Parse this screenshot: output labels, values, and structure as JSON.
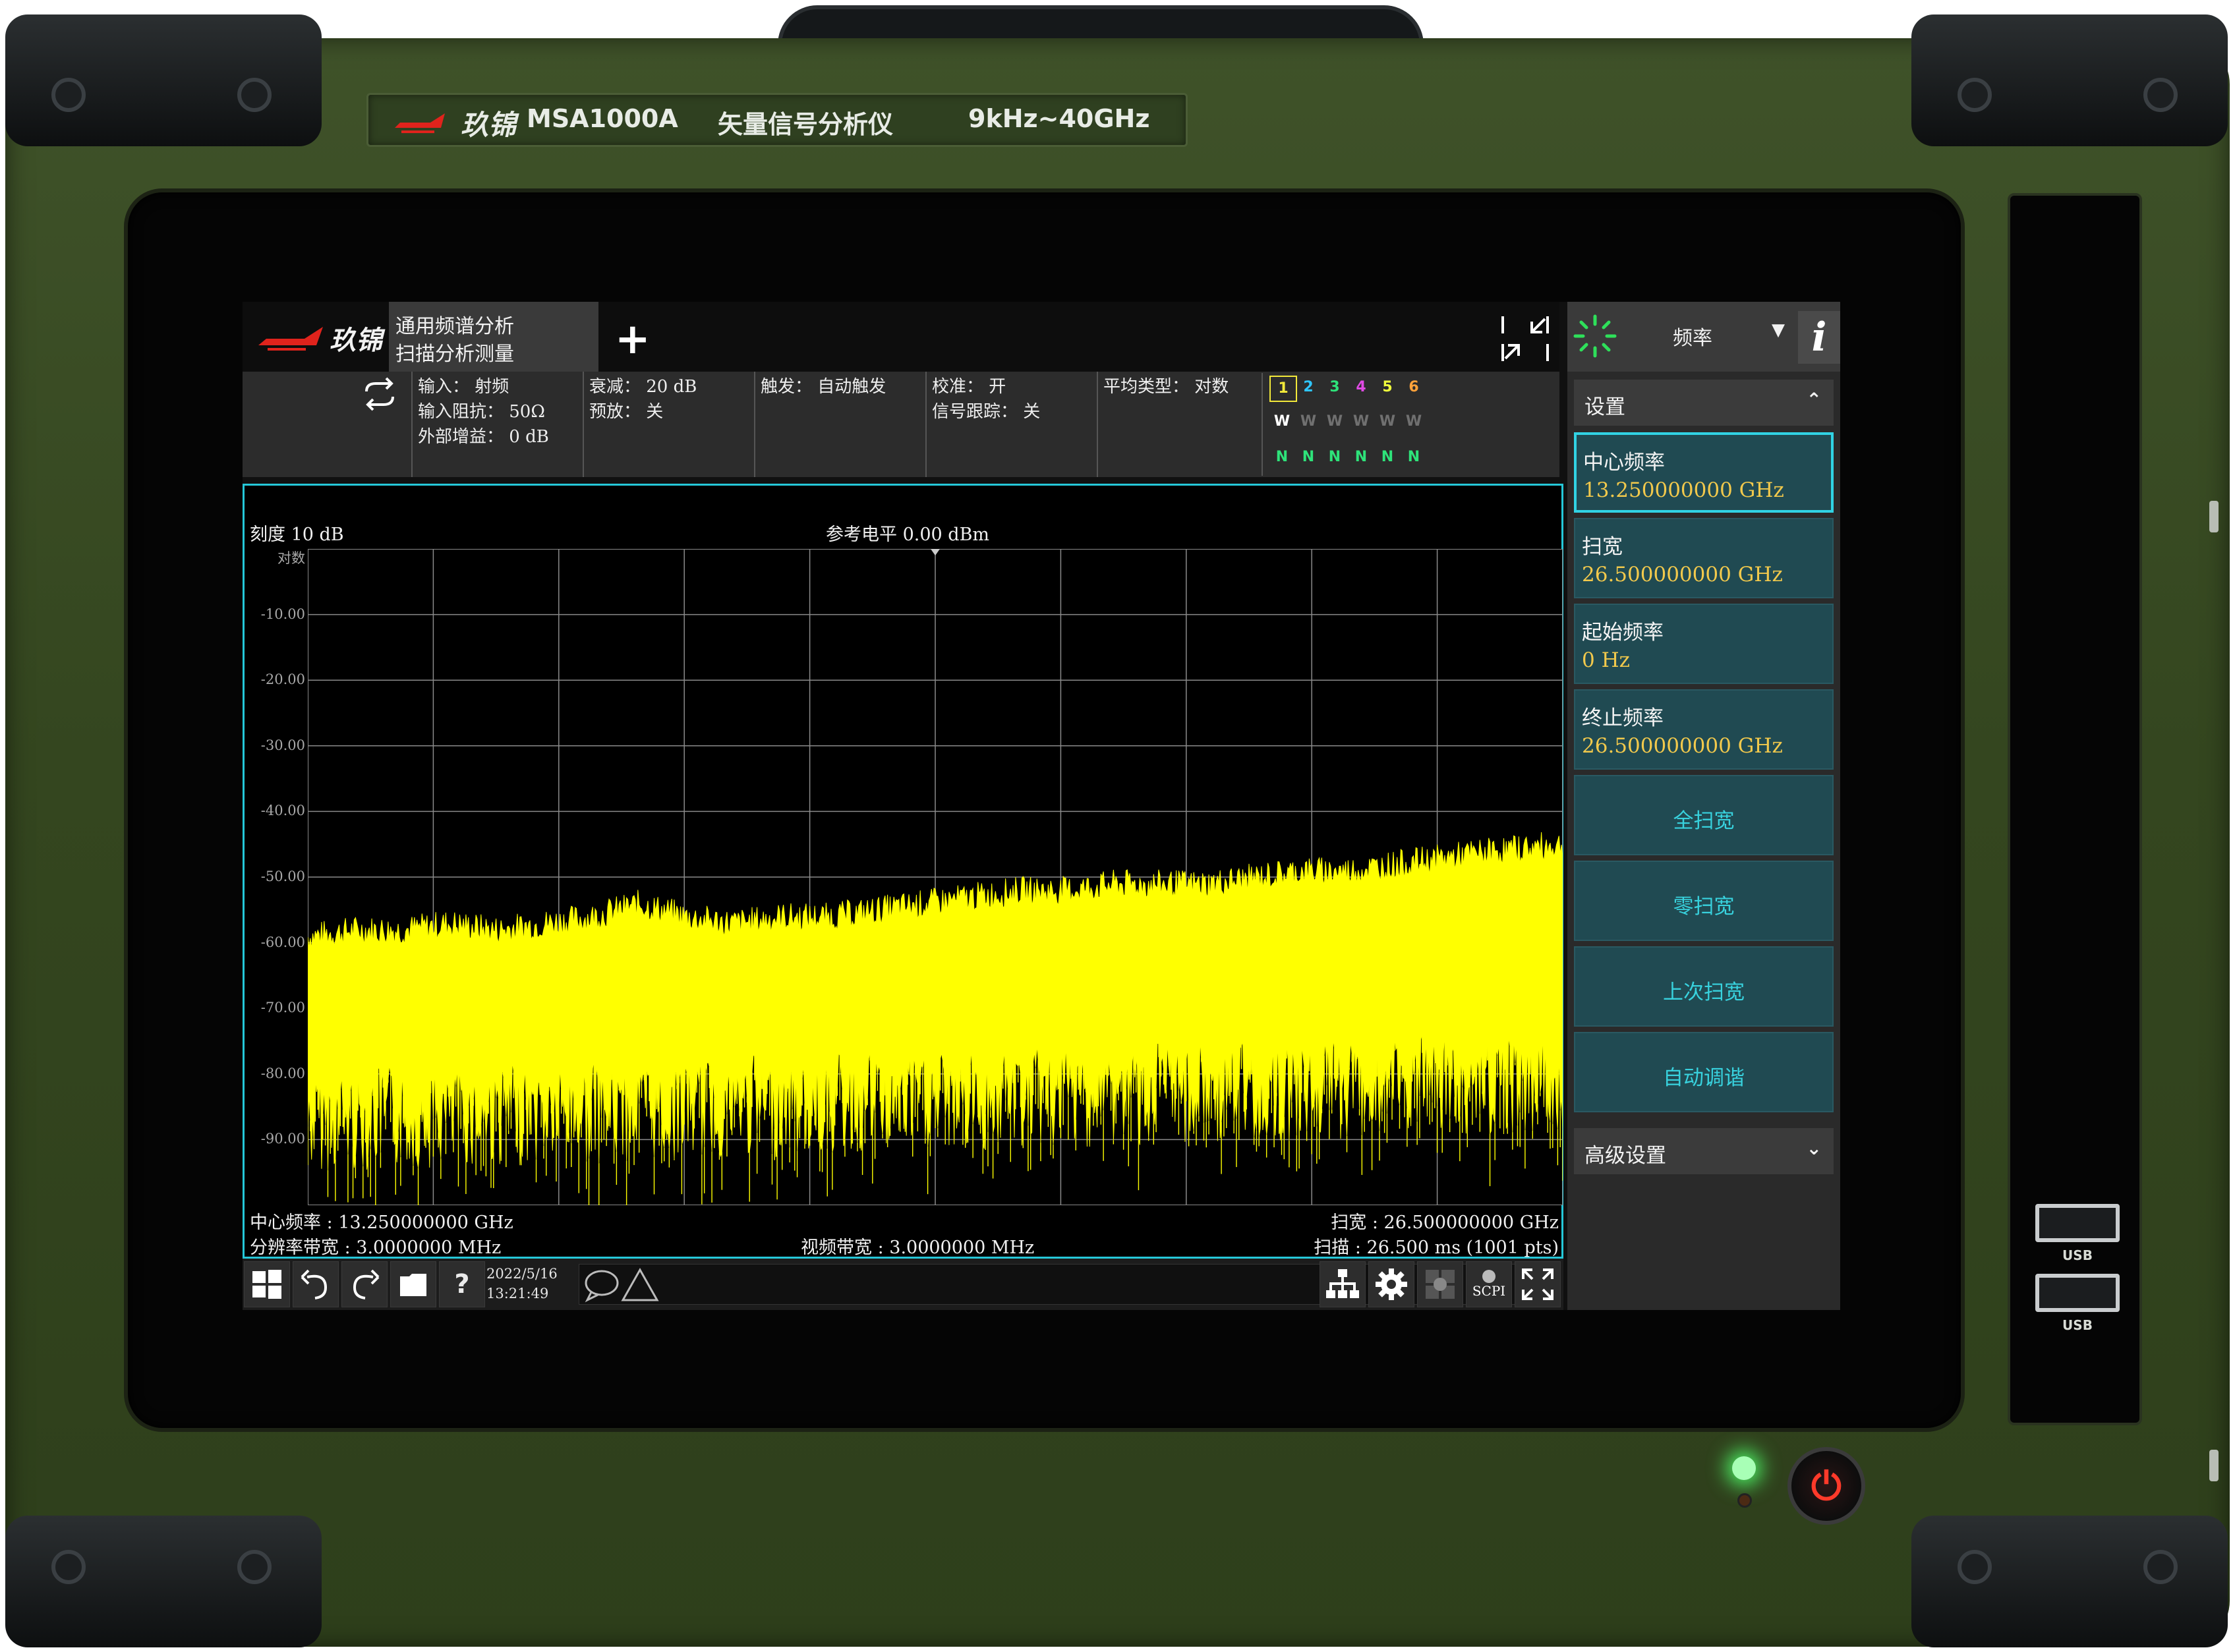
{
  "device": {
    "brand": "玖锦",
    "model": "MSA1000A",
    "description": "矢量信号分析仪",
    "range": "9kHz~40GHz",
    "usb_label": "USB",
    "chassis_color": "#34461f",
    "led_color": "#4fff6a",
    "power_icon": "power-icon"
  },
  "header": {
    "brand": "玖锦",
    "measurement_line1": "通用频谱分析",
    "measurement_line2": "扫描分析测量",
    "add_label": "+",
    "restore_icon": "restore-icon"
  },
  "status": {
    "col1": [
      "输入： 射频",
      "输入阻抗： 50Ω",
      "外部增益： 0 dB"
    ],
    "col2": [
      "衰减： 20 dB",
      "预放： 关"
    ],
    "col3": [
      "触发： 自动触发"
    ],
    "col4": [
      "校准： 开",
      "信号跟踪： 关"
    ],
    "col5": [
      "平均类型： 对数"
    ],
    "traces": {
      "numbers": [
        "1",
        "2",
        "3",
        "4",
        "5",
        "6"
      ],
      "number_colors": [
        "#f2e93a",
        "#2fc6ff",
        "#2ee37a",
        "#e04ae4",
        "#f0ff3c",
        "#ffa23a"
      ],
      "modes": [
        "W",
        "W",
        "W",
        "W",
        "W",
        "W"
      ],
      "detectors": [
        "N",
        "N",
        "N",
        "N",
        "N",
        "N"
      ]
    }
  },
  "graph": {
    "scale": "刻度 10 dB",
    "ref_level": "参考电平 0.00 dBm",
    "log_label": "对数",
    "y_ticks": [
      "-10.00",
      "-20.00",
      "-30.00",
      "-40.00",
      "-50.00",
      "-60.00",
      "-70.00",
      "-80.00",
      "-90.00"
    ],
    "center_freq": "中心频率 : 13.250000000 GHz",
    "rbw": "分辨率带宽 : 3.0000000 MHz",
    "vbw": "视频带宽 : 3.0000000 MHz",
    "span": "扫宽 : 26.500000000 GHz",
    "sweep": "扫描 : 26.500 ms (1001 pts)",
    "trace_color": "#ffff00",
    "border_color": "#25c7d8"
  },
  "chart_data": {
    "type": "area",
    "title": "",
    "xlabel": "",
    "ylabel": "",
    "xlim": [
      0,
      26.5
    ],
    "x_unit": "GHz",
    "ylim": [
      -100,
      0
    ],
    "grid": true,
    "series": [
      {
        "name": "",
        "x": [
          0,
          1,
          2,
          3,
          4,
          5,
          6,
          7,
          8,
          9,
          10,
          11,
          12,
          13,
          14,
          15,
          16,
          17,
          18,
          19,
          20,
          21,
          22,
          23,
          24,
          25,
          26.5
        ],
        "values": [
          -60,
          -59,
          -59,
          -58,
          -59,
          -58,
          -57,
          -55,
          -57,
          -58,
          -57,
          -57,
          -56,
          -55,
          -54,
          -53,
          -53,
          -52,
          -52,
          -52,
          -51,
          -50,
          -50,
          -49,
          -48,
          -47,
          -46
        ]
      }
    ]
  },
  "taskbar": {
    "date": "2022/5/16",
    "time": "13:21:49",
    "scpi_label": "SCPI",
    "help_label": "?"
  },
  "panel": {
    "title": "频率",
    "dropdown": "▼",
    "info": "i",
    "settings_label": "设置",
    "settings_chevron": "⌃",
    "advanced_label": "高级设置",
    "advanced_chevron": "⌄",
    "softkeys": [
      {
        "label": "中心频率",
        "value": "13.250000000 GHz"
      },
      {
        "label": "扫宽",
        "value": "26.500000000 GHz"
      },
      {
        "label": "起始频率",
        "value": "0  Hz"
      },
      {
        "label": "终止频率",
        "value": "26.500000000 GHz"
      }
    ],
    "actions": [
      "全扫宽",
      "零扫宽",
      "上次扫宽",
      "自动调谐"
    ]
  }
}
